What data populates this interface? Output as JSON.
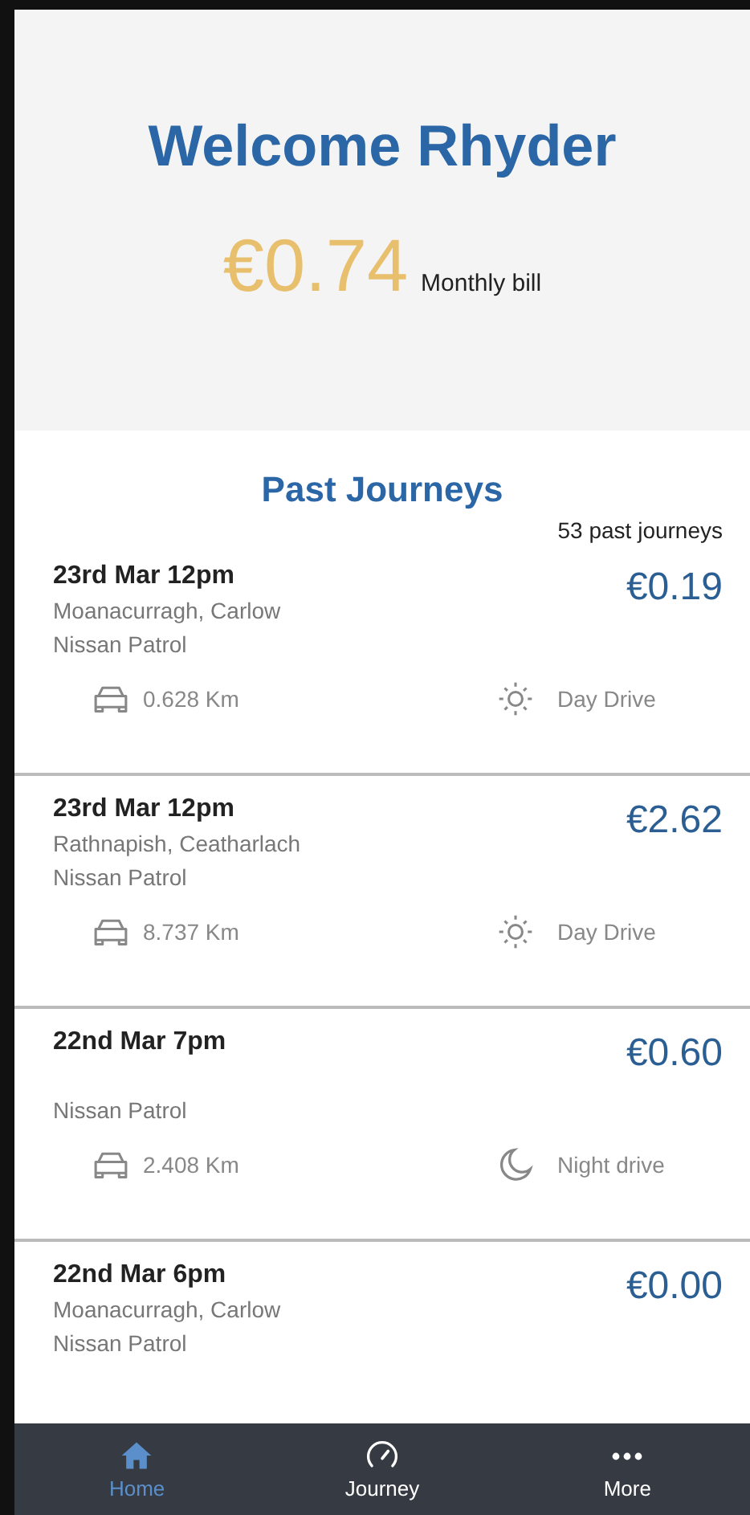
{
  "header": {
    "title": "Welcome Rhyder",
    "bill_amount": "€0.74",
    "bill_label": "Monthly bill"
  },
  "past_journeys": {
    "title": "Past Journeys",
    "count": "53 past journeys",
    "journeys": [
      {
        "date": "23rd Mar 12pm",
        "location": "Moanacurragh, Carlow",
        "vehicle": "Nissan Patrol",
        "cost": "€0.19",
        "distance": "0.628 Km",
        "kind": "day",
        "drive_label": "Day Drive"
      },
      {
        "date": "23rd Mar 12pm",
        "location": "Rathnapish, Ceatharlach",
        "vehicle": "Nissan Patrol",
        "cost": "€2.62",
        "distance": "8.737 Km",
        "kind": "day",
        "drive_label": "Day Drive"
      },
      {
        "date": "22nd Mar 7pm",
        "vehicle": "Nissan Patrol",
        "cost": "€0.60",
        "distance": "2.408 Km",
        "kind": "night",
        "drive_label": "Night drive"
      },
      {
        "date": "22nd Mar 6pm",
        "location": "Moanacurragh, Carlow",
        "vehicle": "Nissan Patrol",
        "cost": "€0.00"
      }
    ]
  },
  "nav": [
    {
      "label": "Home",
      "kind": "home",
      "selected": true
    },
    {
      "label": "Journey",
      "kind": "gauge",
      "selected": false
    },
    {
      "label": "More",
      "kind": "more",
      "selected": false
    }
  ]
}
